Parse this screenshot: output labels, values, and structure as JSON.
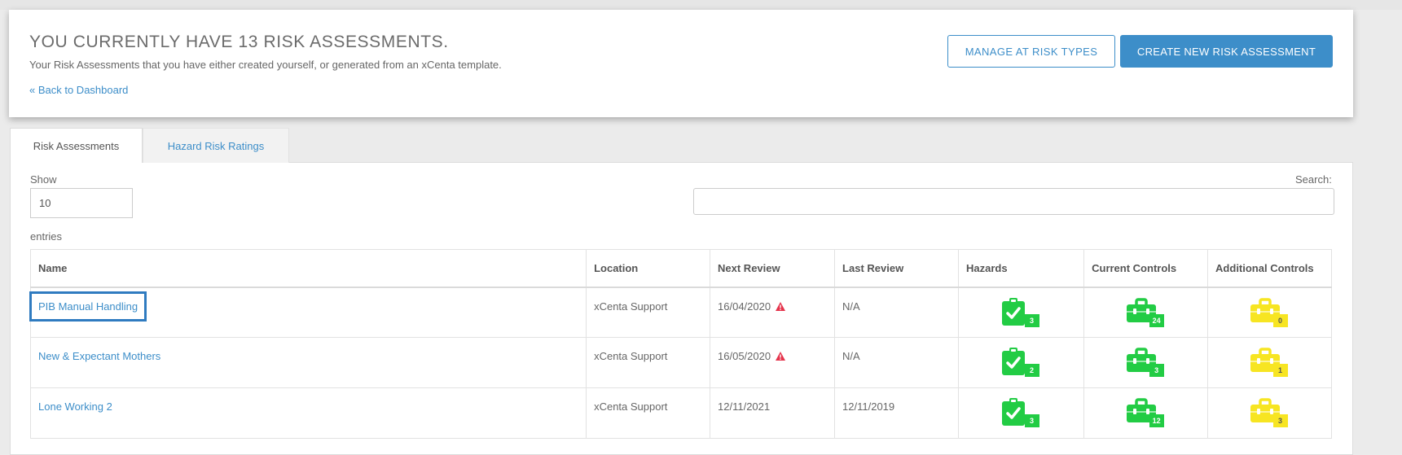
{
  "header": {
    "title": "YOU CURRENTLY HAVE 13 RISK ASSESSMENTS.",
    "subtitle": "Your Risk Assessments that you have either created yourself, or generated from an xCenta template.",
    "back_link": "« Back to Dashboard",
    "manage_button": "MANAGE AT RISK TYPES",
    "create_button": "CREATE NEW RISK ASSESSMENT"
  },
  "tabs": [
    {
      "label": "Risk Assessments",
      "active": true
    },
    {
      "label": "Hazard Risk Ratings",
      "active": false
    }
  ],
  "table_controls": {
    "show_label": "Show",
    "page_length": "10",
    "entries_label": "entries",
    "search_label": "Search:",
    "search_value": ""
  },
  "table": {
    "columns": [
      "Name",
      "Location",
      "Next Review",
      "Last Review",
      "Hazards",
      "Current Controls",
      "Additional Controls"
    ],
    "rows": [
      {
        "name": "PIB Manual Handling",
        "location": "xCenta Support",
        "next_review": "16/04/2020",
        "overdue": true,
        "last_review": "N/A",
        "hazards": "3",
        "current_controls": "24",
        "additional_controls": "0",
        "selected": true
      },
      {
        "name": "New & Expectant Mothers",
        "location": "xCenta Support",
        "next_review": "16/05/2020",
        "overdue": true,
        "last_review": "N/A",
        "hazards": "2",
        "current_controls": "3",
        "additional_controls": "1",
        "selected": false
      },
      {
        "name": "Lone Working 2",
        "location": "xCenta Support",
        "next_review": "12/11/2021",
        "overdue": false,
        "last_review": "12/11/2019",
        "hazards": "3",
        "current_controls": "12",
        "additional_controls": "3",
        "selected": false
      }
    ]
  },
  "icons": {
    "warning": "warning-triangle-icon",
    "hazards": "clipboard-check-icon",
    "current_controls": "toolbox-icon",
    "additional_controls": "toolbox-icon"
  },
  "colors": {
    "accent": "#3d8ec9",
    "green": "#22cc44",
    "yellow": "#f7e522",
    "warning": "#e5334b"
  }
}
